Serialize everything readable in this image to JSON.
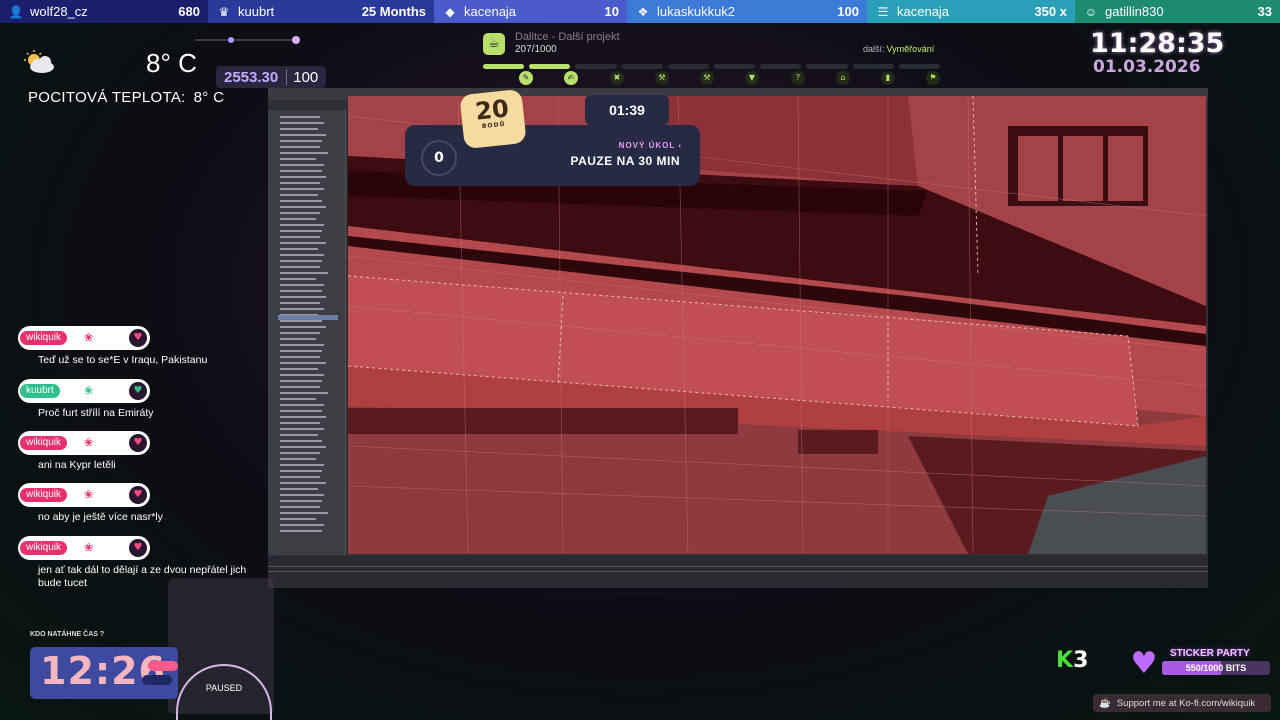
{
  "ticker": [
    {
      "icon": "user-plus-icon",
      "name": "wolf28_cz",
      "value": "680",
      "bg": "#1a1f6e"
    },
    {
      "icon": "crown-icon",
      "name": "kuubrt",
      "value": "25 Months",
      "bg": "#2a3a9a"
    },
    {
      "icon": "diamond-icon",
      "name": "kacenaja",
      "value": "10",
      "bg": "#4a5ccc"
    },
    {
      "icon": "gift-icon",
      "name": "lukaskukkuk2",
      "value": "100",
      "bg": "#3b7bd6"
    },
    {
      "icon": "stack-icon",
      "name": "kacenaja",
      "value": "350 x",
      "bg": "#2aa0b8"
    },
    {
      "icon": "group-icon",
      "name": "gatillin830",
      "value": "33",
      "bg": "#1f8a72"
    }
  ],
  "weather": {
    "temp": "8° C",
    "feels_label": "POCITOVÁ TEPLOTA:",
    "feels_value": "8° C"
  },
  "price": {
    "primary": "2553.30",
    "secondary": "100"
  },
  "goal": {
    "title": "Dalitce - Další projekt",
    "count": "207/1000",
    "next_label": "další:",
    "next_value": "Vyměřování"
  },
  "clock": {
    "time": "11:28:35",
    "date": "01.03.2026"
  },
  "task": {
    "points": "20",
    "points_label": "BODŮ",
    "timer": "01:39",
    "counter": "0",
    "kind": "NOVÝ ÚKOL",
    "title": "PAUZE NA 30 MIN"
  },
  "chat": [
    {
      "user": "wikiquik",
      "color": "#e8306a",
      "text": "Teď už se to se*E v Iraqu, Pakistanu"
    },
    {
      "user": "kuubrt",
      "color": "#2fbf8a",
      "text": "Proč furt střílí na Emiráty"
    },
    {
      "user": "wikiquik",
      "color": "#e8306a",
      "text": "ani na Kypr letěli"
    },
    {
      "user": "wikiquik",
      "color": "#e8306a",
      "text": "no aby je ještě více nasr*ly"
    },
    {
      "user": "wikiquik",
      "color": "#e8306a",
      "text": "jen ať tak dál to dělají a ze dvou nepřátel jich bude tucet"
    }
  ],
  "timer_widget": {
    "label": "KDO NATÁHNE ČAS ?",
    "time": "12:26"
  },
  "paused_label": "PAUSED",
  "sticker": {
    "title": "STICKER PARTY",
    "bits": "550/1000 BITS",
    "progress": 0.55
  },
  "kofi": "Support me at Ko-fi.com/wikiquik",
  "k3": {
    "k": "K",
    "three": "3"
  }
}
